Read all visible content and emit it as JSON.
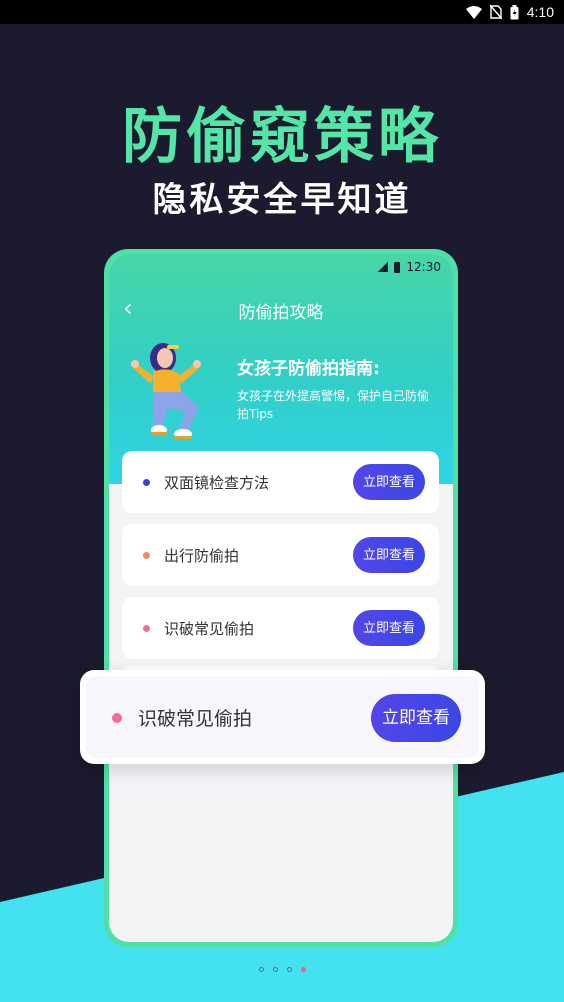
{
  "status_bar": {
    "time": "4:10"
  },
  "headline": "防偷窥策略",
  "subheadline": "隐私安全早知道",
  "phone": {
    "status_time": "12:30",
    "nav_title": "防偷拍攻略",
    "guide_title": "女孩子防偷拍指南:",
    "guide_desc": "女孩子在外提高警惕，保护自己防偷拍Tips",
    "items": [
      {
        "label": "双面镜检查方法",
        "button": "立即查看",
        "dot_color": "#3b3fd8"
      },
      {
        "label": "出行防偷拍",
        "button": "立即查看",
        "dot_color": "#f08a5d"
      },
      {
        "label": "识破常见偷拍",
        "button": "立即查看",
        "dot_color": "#f06aa0"
      }
    ]
  },
  "floating_card": {
    "label": "识破常见偷拍",
    "button": "立即查看",
    "dot_color": "#f06aa0"
  },
  "colors": {
    "accent_green": "#53e6a6",
    "cyan": "#44e1f0",
    "background": "#1b1a2e",
    "button": "#4a46e6"
  },
  "pager": {
    "count": 4,
    "active_index": 3
  }
}
